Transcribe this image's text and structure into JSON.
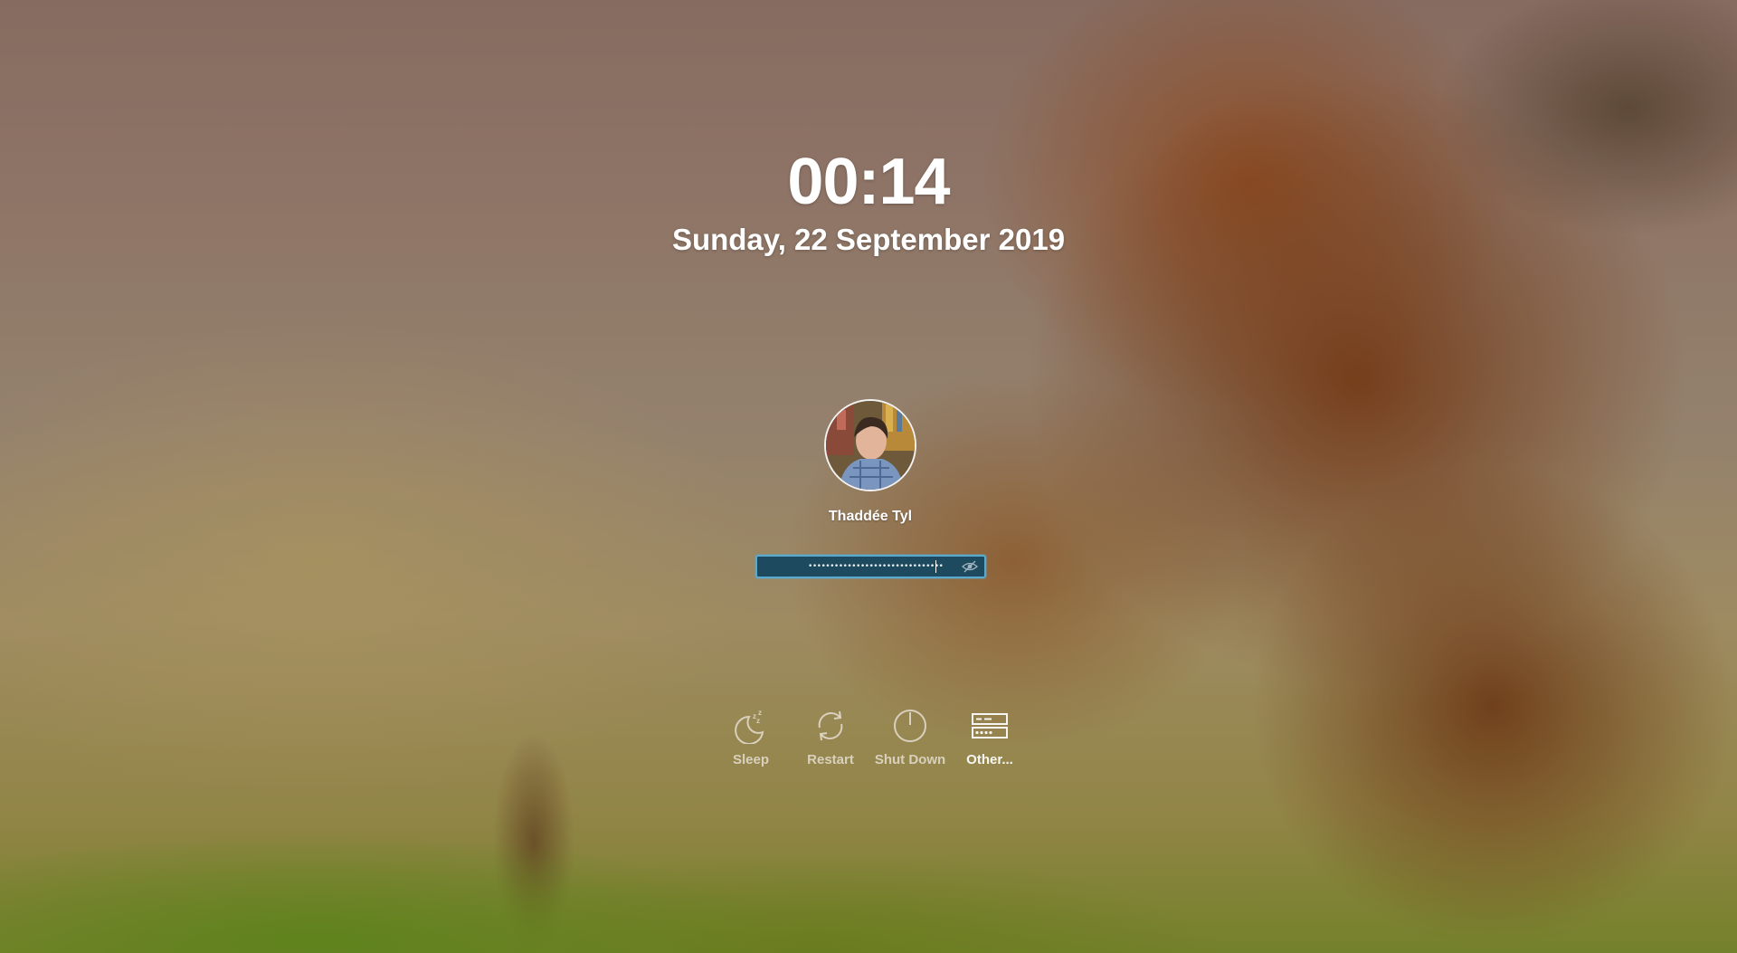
{
  "lock_screen": {
    "time": "00:14",
    "date": "Sunday, 22 September 2019"
  },
  "user": {
    "name": "Thaddée Tyl",
    "avatar": "user-photo"
  },
  "password_field": {
    "masked_value": "•••••••••••••••••••••••••••••••",
    "reveal_icon": "eye-slash-icon",
    "focus_color": "#5aa9cf",
    "fill_color": "#1d4a5e"
  },
  "actions": [
    {
      "label": "Sleep",
      "icon": "sleep-icon"
    },
    {
      "label": "Restart",
      "icon": "restart-icon"
    },
    {
      "label": "Shut Down",
      "icon": "shut-down-icon"
    },
    {
      "label": "Other...",
      "icon": "other-users-icon"
    }
  ]
}
